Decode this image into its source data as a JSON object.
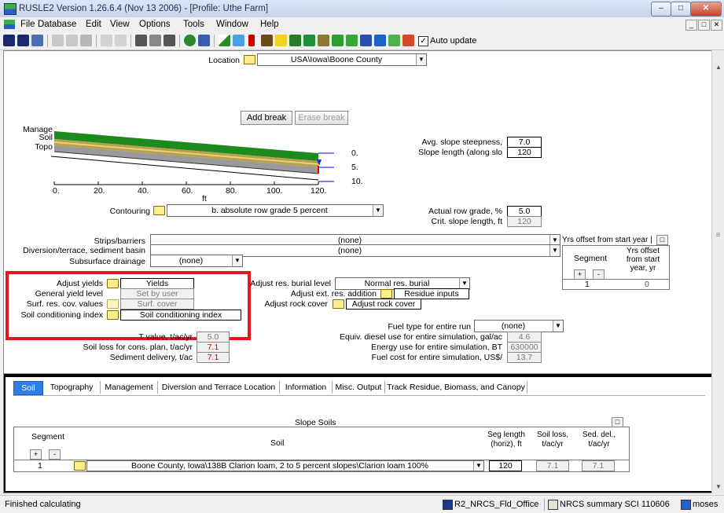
{
  "window": {
    "title": "RUSLE2 Version 1.26.6.4 (Nov 13 2006) - [Profile: Uthe Farm]"
  },
  "menu": [
    "File",
    "Database",
    "Edit",
    "View",
    "Options",
    "Tools",
    "Window",
    "Help"
  ],
  "toolbar": {
    "auto_update_label": "Auto update"
  },
  "location": {
    "label": "Location",
    "value": "USA\\Iowa\\Boone County"
  },
  "profile": {
    "add_break": "Add break",
    "erase_break": "Erase break",
    "layer_labels": [
      "Manage",
      "Soil",
      "Topo"
    ],
    "x_ticks": [
      "0.",
      "20.",
      "40.",
      "60.",
      "80.",
      "100.",
      "120."
    ],
    "x_unit": "ft",
    "y_ticks": [
      "0.",
      "5.",
      "10."
    ]
  },
  "slope": {
    "steepness_label": "Avg. slope steepness,",
    "steepness_value": "7.0",
    "length_label": "Slope length (along slo",
    "length_value": "120"
  },
  "contouring": {
    "label": "Contouring",
    "value": "b. absolute row grade 5 percent"
  },
  "row_grade": {
    "actual_label": "Actual row grade, %",
    "actual_value": "5.0",
    "crit_label": "Crit. slope length, ft",
    "crit_value": "120"
  },
  "practices": {
    "strips_label": "Strips/barriers",
    "strips_value": "(none)",
    "diversion_label": "Diversion/terrace, sediment basin",
    "diversion_value": "(none)",
    "drainage_label": "Subsurface drainage",
    "drainage_value": "(none)"
  },
  "yrs_offset": {
    "header": "Yrs offset from start year |",
    "col_segment": "Segment",
    "col_offset": "Yrs offset from start year, yr",
    "rows": [
      {
        "segment": "1",
        "offset": "0"
      }
    ]
  },
  "adjust": {
    "yields_label": "Adjust yields",
    "yields_value": "Yields",
    "general_label": "General yield level",
    "general_value": "Set by user",
    "surf_label": "Surf. res. cov. values",
    "surf_value": "Surf. cover",
    "soilcond_label": "Soil conditioning index",
    "soilcond_value": "Soil conditioning index",
    "burial_label": "Adjust res. burial level",
    "burial_value": "Normal res. burial",
    "ext_label": "Adjust ext. res. addition",
    "ext_value": "Residue inputs",
    "rock_label": "Adjust rock cover",
    "rock_value": "Adjust rock cover"
  },
  "results": {
    "t_label": "T value, t/ac/yr",
    "t_value": "5.0",
    "soilloss_label": "Soil loss for cons. plan, t/ac/yr",
    "soilloss_value": "7.1",
    "sed_label": "Sediment delivery, t/ac",
    "sed_value": "7.1",
    "fuel_type_label": "Fuel type for entire run",
    "fuel_type_value": "(none)",
    "diesel_label": "Equiv. diesel use for entire simulation, gal/ac",
    "diesel_value": "4.6",
    "energy_label": "Energy use for entire simulation, BT",
    "energy_value": "630000",
    "fuelcost_label": "Fuel cost for entire simulation, US$/",
    "fuelcost_value": "13.7"
  },
  "tabs": [
    "Soil",
    "Topography",
    "Management",
    "Diversion and Terrace Location",
    "Information",
    "Misc. Output",
    "Track Residue, Biomass, and Canopy"
  ],
  "slope_soils": {
    "title": "Slope Soils",
    "col_segment": "Segment",
    "col_soil": "Soil",
    "col_seglen": "Seg length (horiz), ft",
    "col_soilloss": "Soil loss, t/ac/yr",
    "col_seddel": "Sed. del., t/ac/yr",
    "rows": [
      {
        "segment": "1",
        "soil": "Boone County, Iowa\\138B Clarion loam, 2 to 5 percent slopes\\Clarion loam  100%",
        "seglen": "120",
        "soilloss": "7.1",
        "seddel": "7.1"
      }
    ]
  },
  "status": {
    "message": "Finished calculating",
    "office": "R2_NRCS_Fld_Office",
    "summary": "NRCS summary SCI 110606",
    "user": "moses"
  },
  "colors": {
    "red_highlight": "#e8151c",
    "tab_active": "#2f7fe6"
  }
}
